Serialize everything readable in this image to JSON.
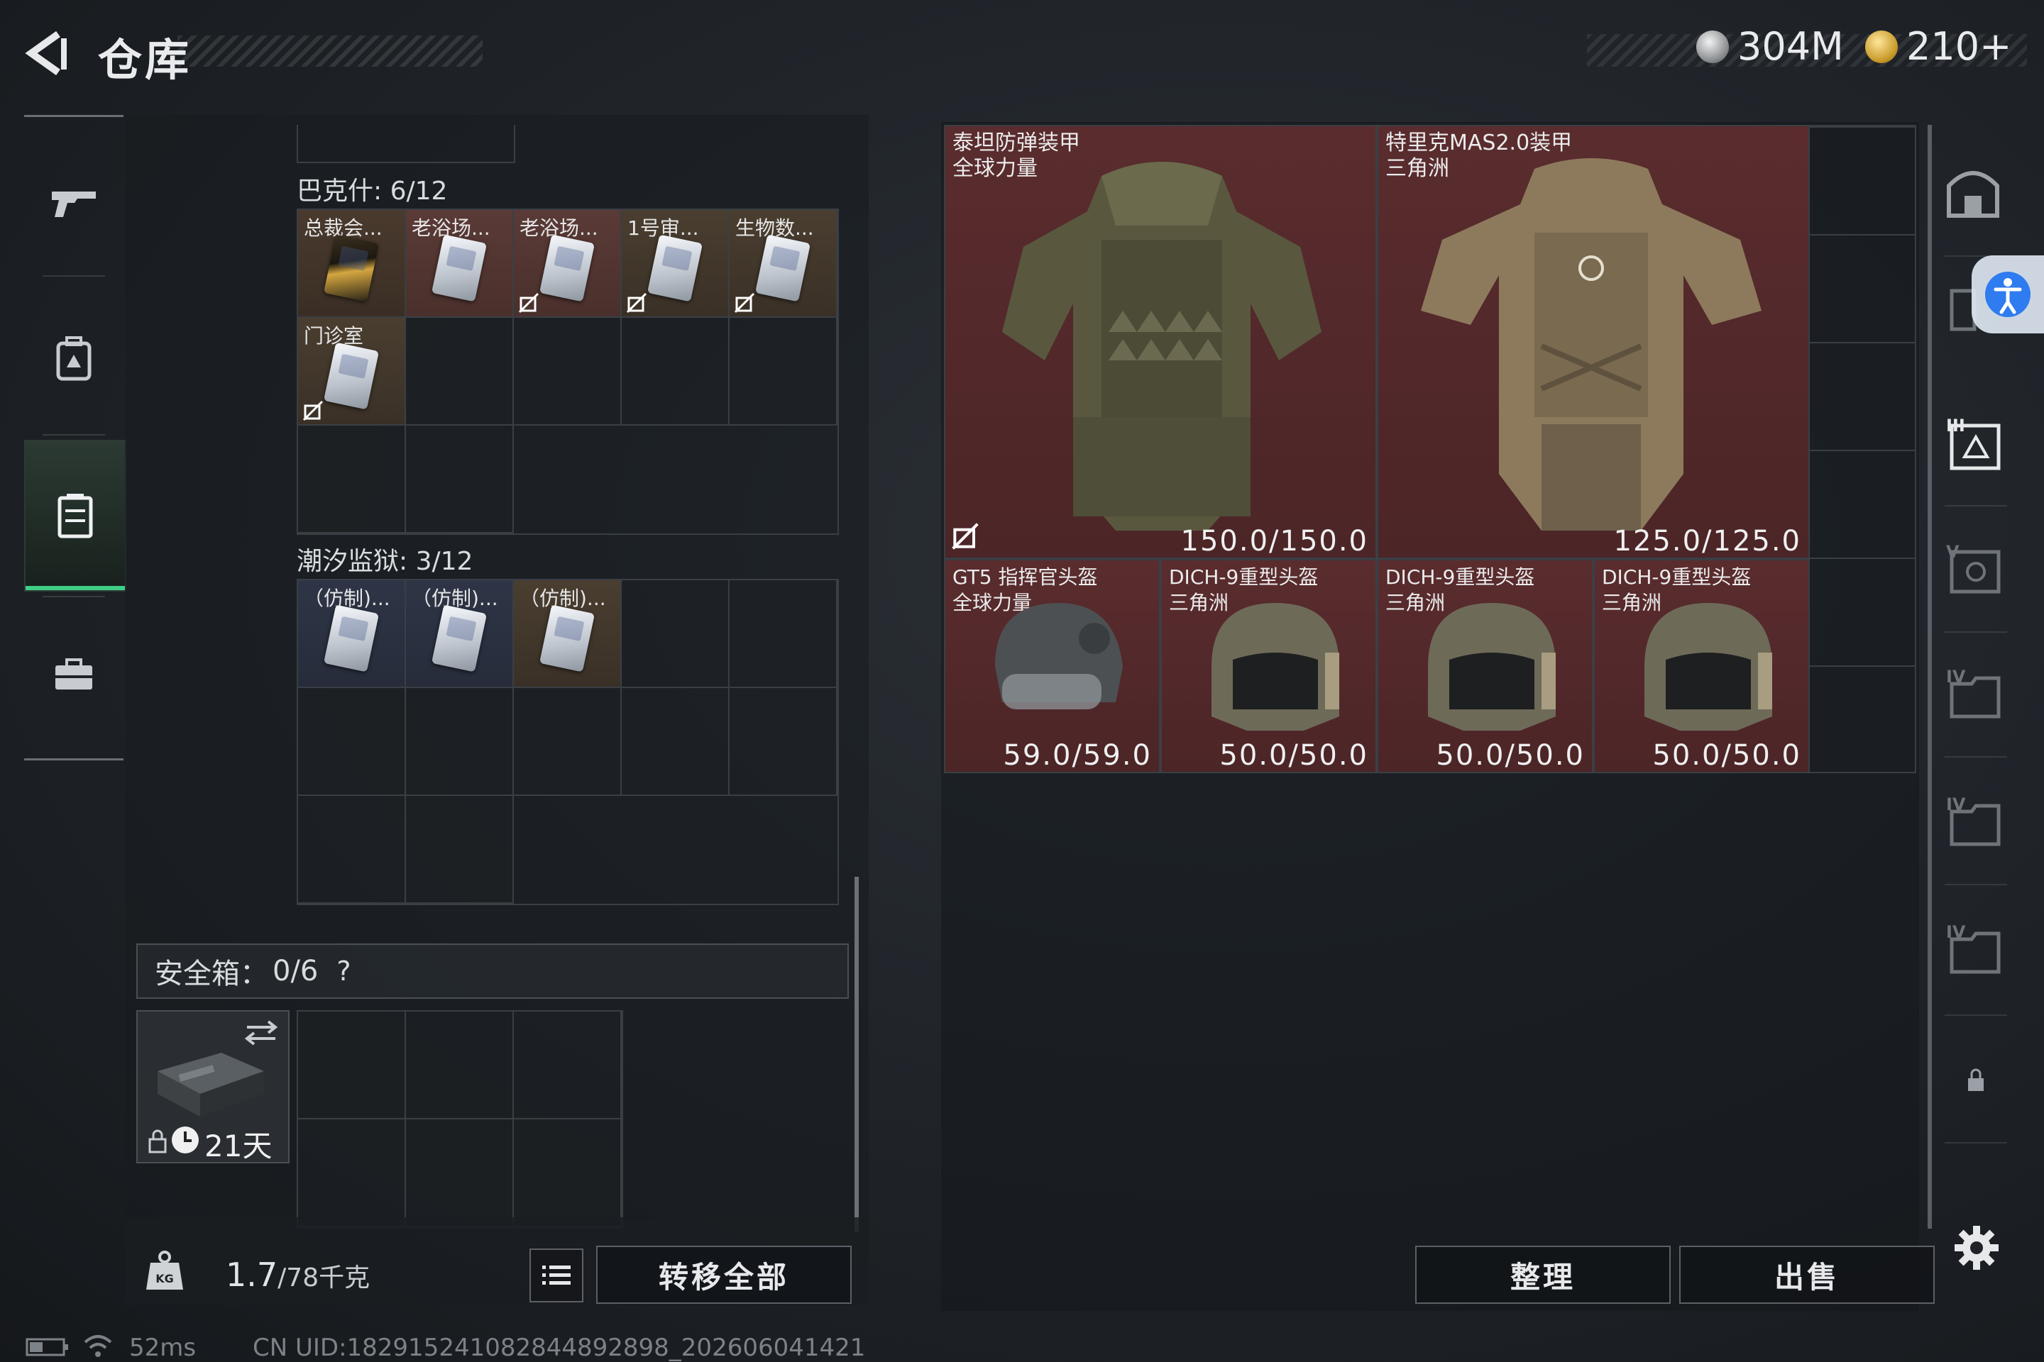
{
  "header": {
    "title": "仓库"
  },
  "currency": {
    "silver": "304M",
    "gold": "210+"
  },
  "sidebar": {
    "items": [
      "weapon-tab",
      "backpack-tab",
      "storage-tab",
      "toolbox-tab"
    ]
  },
  "sections": {
    "bakshi": {
      "label": "巴克什: 6/12",
      "items": [
        "总裁会...",
        "老浴场...",
        "老浴场...",
        "1号审...",
        "生物数...",
        "门诊室"
      ]
    },
    "tidal": {
      "label": "潮汐监狱: 3/12",
      "items": [
        "（仿制)...",
        "（仿制)...",
        "（仿制)..."
      ]
    }
  },
  "safe_box": {
    "label": "安全箱：",
    "count": "0/6",
    "help": "?",
    "days": "21天"
  },
  "footer_left": {
    "weight_value": "1.7",
    "weight_unit": "/78千克",
    "transfer_all": "转移全部"
  },
  "stash": {
    "armors": [
      {
        "name1": "泰坦防弹装甲",
        "name2": "全球力量",
        "durability": "150.0/150.0"
      },
      {
        "name1": "特里克MAS2.0装甲",
        "name2": "三角洲",
        "durability": "125.0/125.0"
      }
    ],
    "helmets": [
      {
        "name1": "GT5 指挥官头盔",
        "name2": "全球力量",
        "durability": "59.0/59.0"
      },
      {
        "name1": "DICH-9重型头盔",
        "name2": "三角洲",
        "durability": "50.0/50.0"
      },
      {
        "name1": "DICH-9重型头盔",
        "name2": "三角洲",
        "durability": "50.0/50.0"
      },
      {
        "name1": "DICH-9重型头盔",
        "name2": "三角洲",
        "durability": "50.0/50.0"
      }
    ]
  },
  "actions": {
    "sort": "整理",
    "sell": "出售"
  },
  "status": {
    "ping": "52ms",
    "uid": "CN UID:182915241082844892898_202606041421"
  },
  "colors": {
    "accent_green": "#3fcf86",
    "card_red": "#5a2c2e",
    "accessibility_blue": "#2f7bf0"
  }
}
